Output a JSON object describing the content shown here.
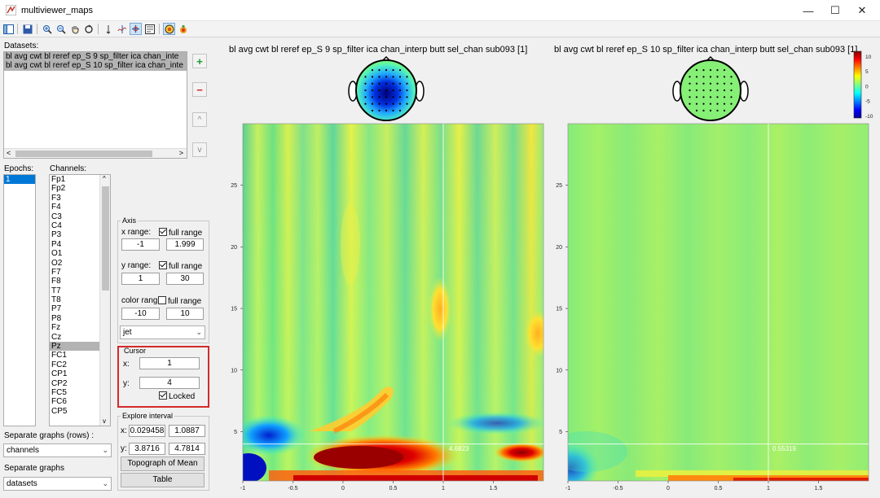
{
  "window": {
    "title": "multiviewer_maps",
    "minimize": "—",
    "maximize": "☐",
    "close": "✕"
  },
  "toolbar": {
    "icons": [
      "panel-layout-icon",
      "save-icon",
      "zoom-in-icon",
      "zoom-out-icon",
      "pan-hand-icon",
      "rotate-icon",
      "cursor-arrow-icon",
      "data-cursor-icon",
      "link-axes-icon",
      "legend-icon",
      "topography-icon",
      "color-topo-icon"
    ]
  },
  "datasets": {
    "label": "Datasets:",
    "items": [
      "bl avg cwt bl reref ep_S  9 sp_filter ica chan_inte",
      "bl avg cwt bl reref ep_S 10 sp_filter ica chan_inte"
    ],
    "add": "+",
    "remove": "−",
    "up": "^",
    "down": "v"
  },
  "epochs": {
    "label": "Epochs:",
    "items": [
      "1"
    ]
  },
  "channels": {
    "label": "Channels:",
    "items": [
      "Fp1",
      "Fp2",
      "F3",
      "F4",
      "C3",
      "C4",
      "P3",
      "P4",
      "O1",
      "O2",
      "F7",
      "F8",
      "T7",
      "T8",
      "P7",
      "P8",
      "Fz",
      "Cz",
      "Pz",
      "FC1",
      "FC2",
      "CP1",
      "CP2",
      "FC5",
      "FC6",
      "CP5"
    ],
    "selected": "Pz"
  },
  "axis": {
    "title": "Axis",
    "x_label": "x range:",
    "x_full": "full range",
    "x_min": "-1",
    "x_max": "1.999",
    "y_label": "y range:",
    "y_full": "full range",
    "y_min": "1",
    "y_max": "30",
    "c_label": "color range",
    "c_full": "full range",
    "c_min": "-10",
    "c_max": "10",
    "colormap": "jet"
  },
  "cursor": {
    "title": "Cursor",
    "x_label": "x:",
    "x": "1",
    "y_label": "y:",
    "y": "4",
    "locked": "Locked"
  },
  "explore": {
    "title": "Explore interval",
    "x_label": "x:",
    "x1": "0.029458",
    "x2": "1.0887",
    "y_label": "y:",
    "y1": "3.8716",
    "y2": "4.7814",
    "topo_btn": "Topograph of Mean",
    "table_btn": "Table"
  },
  "rows": {
    "label": "Separate graphs (rows) :",
    "value": "channels"
  },
  "cols": {
    "label": "Separate graphs",
    "value": "datasets"
  },
  "plots": [
    {
      "title": "bl avg cwt bl reref ep_S  9 sp_filter ica chan_interp butt sel_chan sub093 [1]",
      "cursor_value": "4.6823"
    },
    {
      "title": "bl avg cwt bl reref ep_S 10 sp_filter ica chan_interp butt sel_chan sub093 [1]",
      "cursor_value": "0.55319"
    }
  ],
  "chart_data": {
    "type": "heatmap",
    "xlim": [
      -1,
      2
    ],
    "ylim": [
      1,
      30
    ],
    "xticks": [
      "-1",
      "-0.5",
      "0",
      "0.5",
      "1",
      "1.5"
    ],
    "yticks": [
      "5",
      "10",
      "15",
      "20",
      "25"
    ],
    "colorbar_ticks": [
      "10",
      "5",
      "0",
      "-5",
      "-10"
    ],
    "colormap": "jet",
    "clim": [
      -10,
      10
    ],
    "cursor": {
      "x": 1,
      "y": 4
    }
  },
  "colors": {
    "red_highlight": "#d42a2a",
    "jet_low": "#00008f",
    "jet_mid": "#7fff7f",
    "jet_high": "#800000"
  }
}
